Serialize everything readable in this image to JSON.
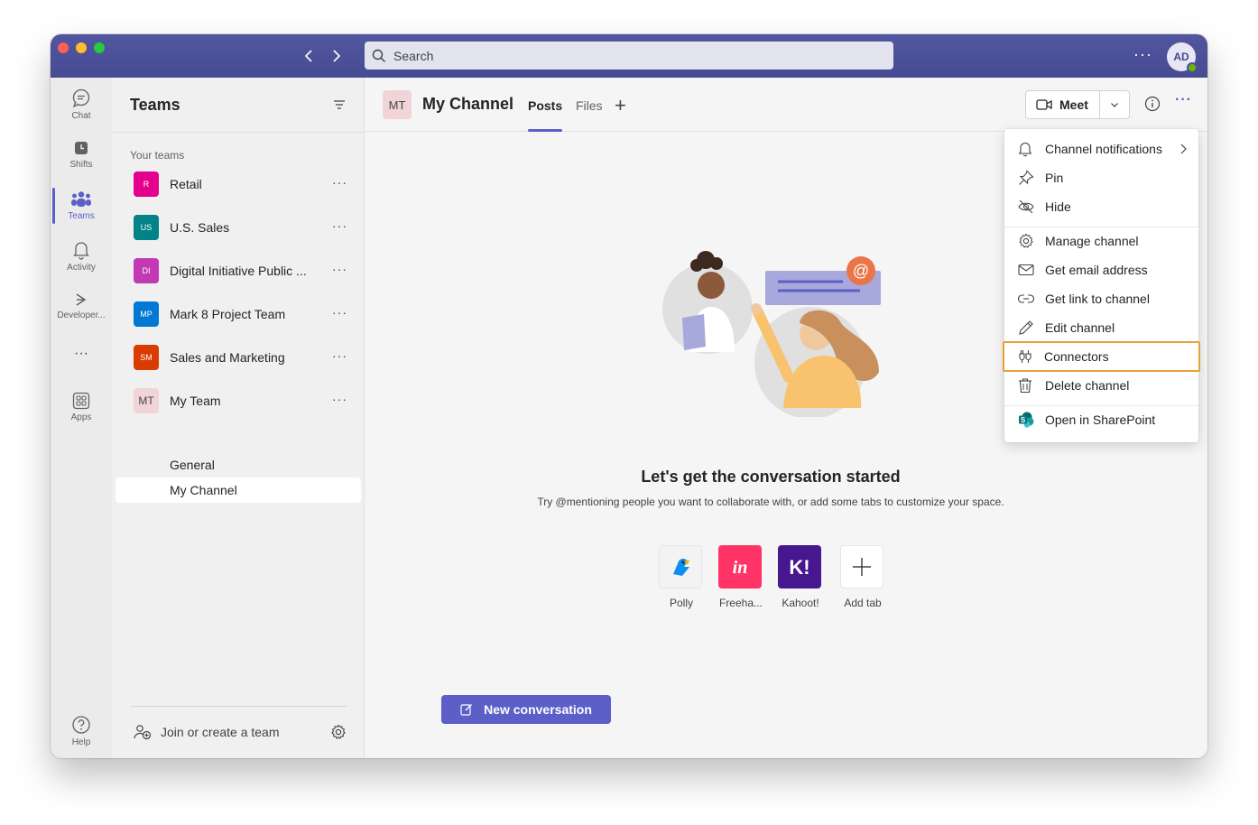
{
  "titlebar": {
    "back_label": "‹",
    "forward_label": "›",
    "search_placeholder": "Search",
    "more_label": "···",
    "avatar_initials": "AD"
  },
  "rail": {
    "items": [
      {
        "label": "Chat"
      },
      {
        "label": "Shifts"
      },
      {
        "label": "Teams"
      },
      {
        "label": "Activity"
      },
      {
        "label": "Developer..."
      },
      {
        "label": "···"
      },
      {
        "label": "Apps"
      },
      {
        "label": "Help"
      }
    ]
  },
  "panel": {
    "title": "Teams",
    "section_label": "Your teams",
    "teams": [
      {
        "initials": "R",
        "name": "Retail",
        "color": "#e3008c"
      },
      {
        "initials": "US",
        "name": "U.S. Sales",
        "color": "#038387"
      },
      {
        "initials": "DI",
        "name": "Digital Initiative Public ...",
        "color": "#c239b3"
      },
      {
        "initials": "MP",
        "name": "Mark 8 Project Team",
        "color": "#0078d4"
      },
      {
        "initials": "SM",
        "name": "Sales and Marketing",
        "color": "#da3b01"
      },
      {
        "initials": "MT",
        "name": "My Team",
        "color": "#f1d4d8"
      }
    ],
    "team_more": "···",
    "channels": [
      {
        "name": "General"
      },
      {
        "name": "My Channel"
      }
    ],
    "join_label": "Join or create a team"
  },
  "main": {
    "channel_initials": "MT",
    "channel_title": "My Channel",
    "tabs": [
      {
        "label": "Posts"
      },
      {
        "label": "Files"
      }
    ],
    "tab_add": "+",
    "meet_label": "Meet",
    "more_label": "···",
    "empty_title": "Let's get the conversation started",
    "empty_subtitle": "Try @mentioning people you want to collaborate with, or add some tabs to customize your space.",
    "apps": [
      {
        "label": "Polly"
      },
      {
        "label": "Freeha..."
      },
      {
        "label": "Kahoot!"
      },
      {
        "label": "Add tab"
      }
    ],
    "new_conversation_label": "New conversation"
  },
  "menu": {
    "items": [
      {
        "label": "Channel notifications",
        "icon": "bell-icon"
      },
      {
        "label": "Pin",
        "icon": "pin-icon"
      },
      {
        "label": "Hide",
        "icon": "eye-off-icon"
      },
      {
        "label": "Manage channel",
        "icon": "gear-icon"
      },
      {
        "label": "Get email address",
        "icon": "mail-icon"
      },
      {
        "label": "Get link to channel",
        "icon": "link-icon"
      },
      {
        "label": "Edit channel",
        "icon": "pencil-icon"
      },
      {
        "label": "Connectors",
        "icon": "plug-icon"
      },
      {
        "label": "Delete channel",
        "icon": "trash-icon"
      },
      {
        "label": "Open in SharePoint",
        "icon": "sharepoint-icon"
      }
    ],
    "highlighted_item": "Connectors",
    "highlight_color": "#e8a13a"
  },
  "colors": {
    "titlebar": "#4b4f99",
    "accent": "#5b5fc7"
  }
}
